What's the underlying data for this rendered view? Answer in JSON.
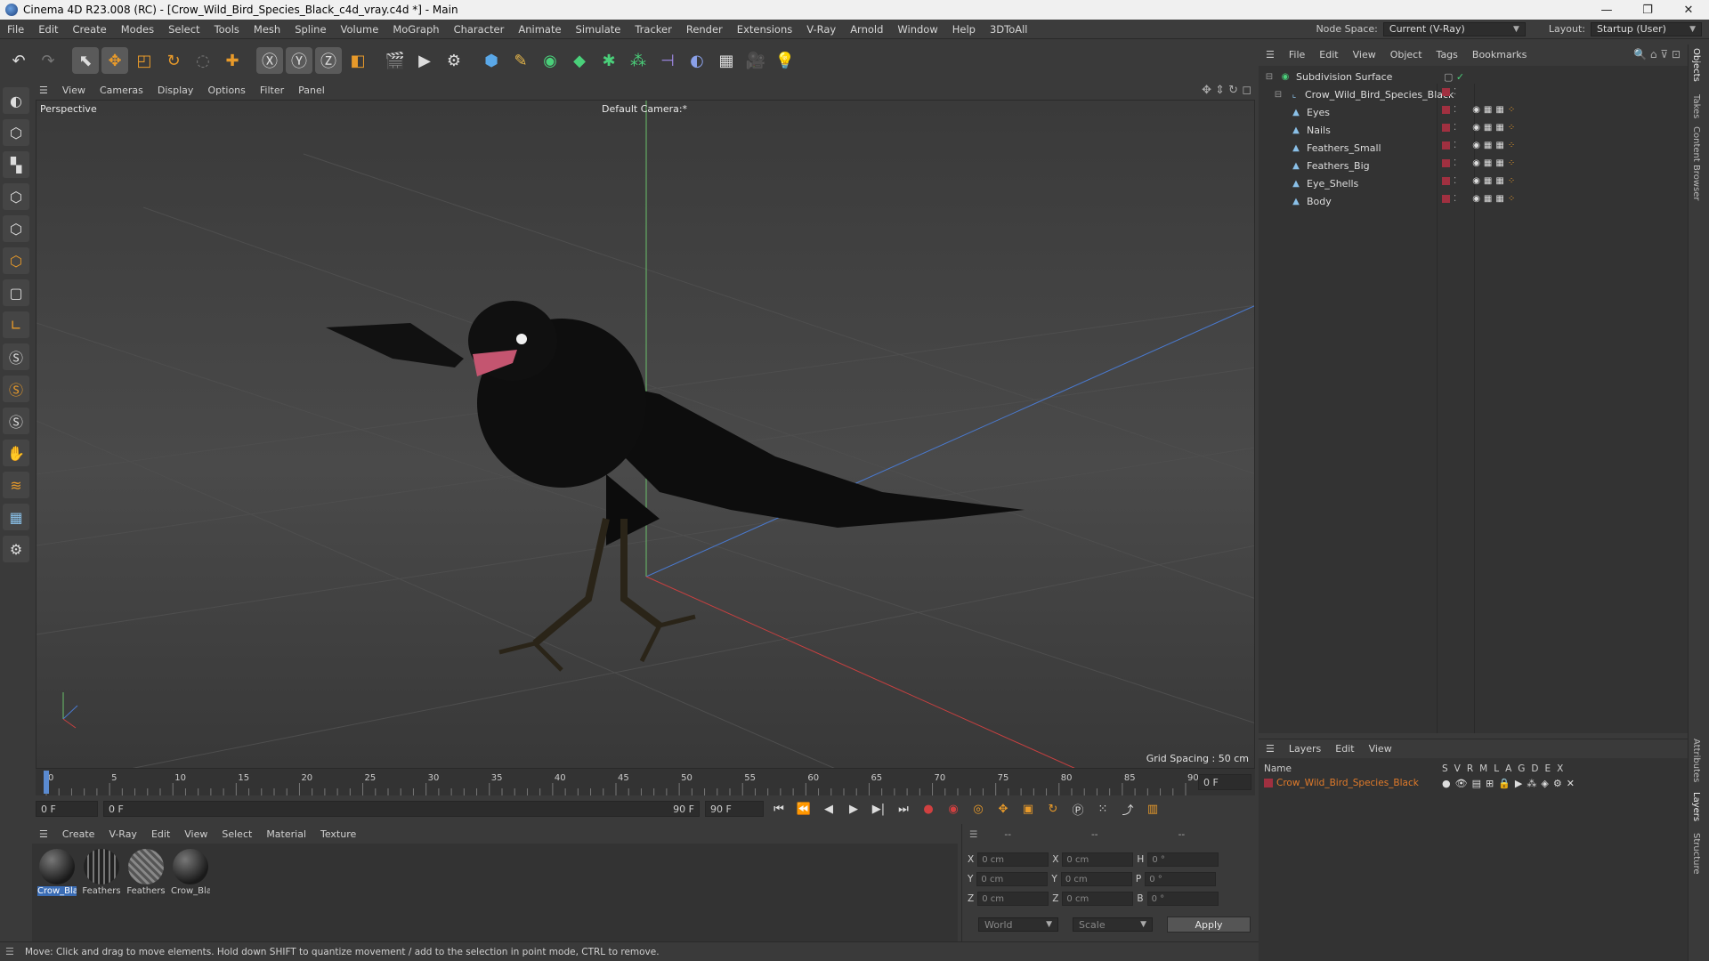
{
  "window": {
    "title": "Cinema 4D R23.008 (RC) - [Crow_Wild_Bird_Species_Black_c4d_vray.c4d *] - Main",
    "controls": [
      "—",
      "❐",
      "✕"
    ]
  },
  "menubar": {
    "items": [
      "File",
      "Edit",
      "Create",
      "Modes",
      "Select",
      "Tools",
      "Mesh",
      "Spline",
      "Volume",
      "MoGraph",
      "Character",
      "Animate",
      "Simulate",
      "Tracker",
      "Render",
      "Extensions",
      "V-Ray",
      "Arnold",
      "Window",
      "Help",
      "3DToAll"
    ],
    "node_space_label": "Node Space:",
    "node_space_value": "Current (V-Ray)",
    "layout_label": "Layout:",
    "layout_value": "Startup (User)"
  },
  "viewport": {
    "menu": [
      "View",
      "Cameras",
      "Display",
      "Options",
      "Filter",
      "Panel"
    ],
    "view_name": "Perspective",
    "camera": "Default Camera:*",
    "grid_spacing": "Grid Spacing : 50 cm"
  },
  "timeline": {
    "ticks": [
      "0",
      "5",
      "10",
      "15",
      "20",
      "25",
      "30",
      "35",
      "40",
      "45",
      "50",
      "55",
      "60",
      "65",
      "70",
      "75",
      "80",
      "85",
      "90"
    ],
    "current_frame_right": "0 F",
    "start_field": "0 F",
    "range_start": "0 F",
    "range_end": "90 F",
    "end_field": "90 F"
  },
  "materials": {
    "menu": [
      "Create",
      "V-Ray",
      "Edit",
      "View",
      "Select",
      "Material",
      "Texture"
    ],
    "items": [
      {
        "name": "Crow_Bla"
      },
      {
        "name": "Feathers"
      },
      {
        "name": "Feathers"
      },
      {
        "name": "Crow_Bla"
      }
    ]
  },
  "coordinates": {
    "header": [
      "--",
      "--",
      "--"
    ],
    "rows": [
      {
        "axis1": "X",
        "v1": "0 cm",
        "axis2": "X",
        "v2": "0 cm",
        "axis3": "H",
        "v3": "0 °"
      },
      {
        "axis1": "Y",
        "v1": "0 cm",
        "axis2": "Y",
        "v2": "0 cm",
        "axis3": "P",
        "v3": "0 °"
      },
      {
        "axis1": "Z",
        "v1": "0 cm",
        "axis2": "Z",
        "v2": "0 cm",
        "axis3": "B",
        "v3": "0 °"
      }
    ],
    "space": "World",
    "mode": "Scale",
    "apply": "Apply"
  },
  "status": "Move: Click and drag to move elements. Hold down SHIFT to quantize movement / add to the selection in point mode, CTRL to remove.",
  "objects": {
    "menu": [
      "File",
      "Edit",
      "View",
      "Object",
      "Tags",
      "Bookmarks"
    ],
    "items": [
      {
        "name": "Subdivision Surface"
      },
      {
        "name": "Crow_Wild_Bird_Species_Black"
      },
      {
        "name": "Eyes"
      },
      {
        "name": "Nails"
      },
      {
        "name": "Feathers_Small"
      },
      {
        "name": "Feathers_Big"
      },
      {
        "name": "Eye_Shells"
      },
      {
        "name": "Body"
      }
    ]
  },
  "layers": {
    "menu": [
      "Layers",
      "Edit",
      "View"
    ],
    "col_name": "Name",
    "cols": [
      "S",
      "V",
      "R",
      "M",
      "L",
      "A",
      "G",
      "D",
      "E",
      "X"
    ],
    "items": [
      {
        "name": "Crow_Wild_Bird_Species_Black"
      }
    ]
  },
  "side_tabs": [
    "Objects",
    "Takes",
    "Content Browser",
    "Attributes",
    "Layers",
    "Structure"
  ],
  "colors": {
    "accent": "#3b6db5",
    "layer_name": "#e07a2a",
    "axis_x": "#c84040",
    "axis_y": "#6ac06a",
    "axis_z": "#4a7ad0"
  }
}
